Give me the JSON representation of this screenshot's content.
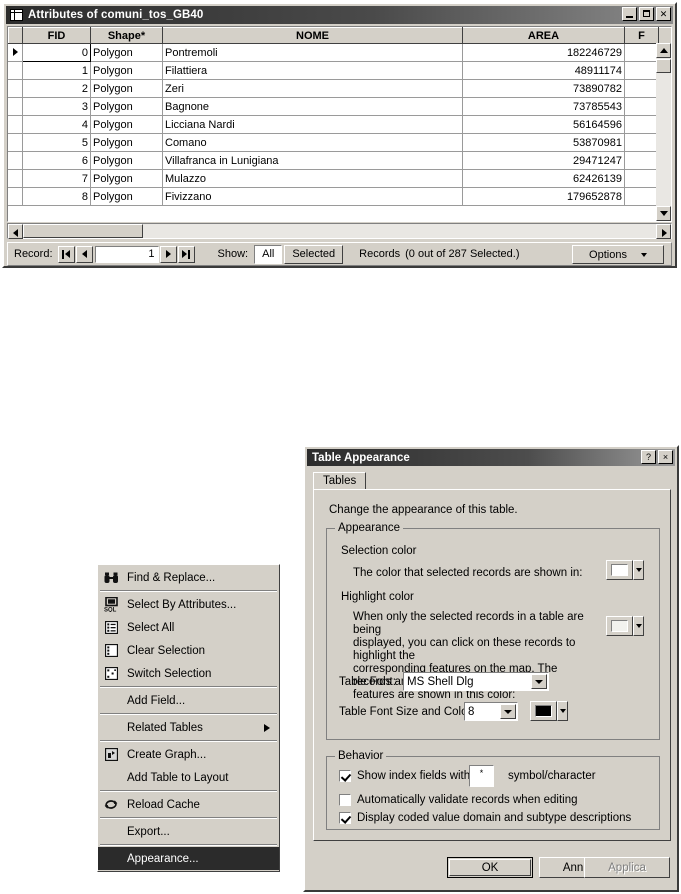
{
  "attribute_table": {
    "title": "Attributes of comuni_tos_GB40",
    "title_icon": "table-icon",
    "window_buttons": {
      "minimize": "minimize-icon",
      "maximize": "maximize-icon",
      "close": "close-icon"
    },
    "columns": [
      "FID",
      "Shape*",
      "NOME",
      "AREA",
      "F"
    ],
    "rows": [
      {
        "fid": "0",
        "shape": "Polygon",
        "nome": "Pontremoli",
        "area": "182246729"
      },
      {
        "fid": "1",
        "shape": "Polygon",
        "nome": "Filattiera",
        "area": "48911174"
      },
      {
        "fid": "2",
        "shape": "Polygon",
        "nome": "Zeri",
        "area": "73890782"
      },
      {
        "fid": "3",
        "shape": "Polygon",
        "nome": "Bagnone",
        "area": "73785543"
      },
      {
        "fid": "4",
        "shape": "Polygon",
        "nome": "Licciana Nardi",
        "area": "56164596"
      },
      {
        "fid": "5",
        "shape": "Polygon",
        "nome": "Comano",
        "area": "53870981"
      },
      {
        "fid": "6",
        "shape": "Polygon",
        "nome": "Villafranca in Lunigiana",
        "area": "29471247"
      },
      {
        "fid": "7",
        "shape": "Polygon",
        "nome": "Mulazzo",
        "area": "62426139"
      },
      {
        "fid": "8",
        "shape": "Polygon",
        "nome": "Fivizzano",
        "area": "179652878"
      }
    ],
    "statusbar": {
      "record_label": "Record:",
      "record_value": "1",
      "first_icon": "first-record-icon",
      "prev_icon": "previous-record-icon",
      "next_icon": "next-record-icon",
      "last_icon": "last-record-icon",
      "show_label": "Show:",
      "show_all": "All",
      "show_selected": "Selected",
      "records_label": "Records",
      "records_status": "(0 out of 287 Selected.)",
      "options_label": "Options"
    }
  },
  "context_menu": {
    "items": [
      {
        "label": "Find & Replace...",
        "icon": "binoculars-icon",
        "separator_after": true,
        "submenu": false,
        "highlighted": false
      },
      {
        "label": "Select By Attributes...",
        "icon": "sql-monitor-icon",
        "separator_after": false,
        "submenu": false,
        "highlighted": false
      },
      {
        "label": "Select All",
        "icon": "select-all-icon",
        "separator_after": false,
        "submenu": false,
        "highlighted": false
      },
      {
        "label": "Clear Selection",
        "icon": "clear-selection-icon",
        "separator_after": false,
        "submenu": false,
        "highlighted": false
      },
      {
        "label": "Switch Selection",
        "icon": "switch-selection-icon",
        "separator_after": true,
        "submenu": false,
        "highlighted": false
      },
      {
        "label": "Add Field...",
        "icon": "",
        "separator_after": true,
        "submenu": false,
        "highlighted": false
      },
      {
        "label": "Related Tables",
        "icon": "",
        "separator_after": true,
        "submenu": true,
        "highlighted": false
      },
      {
        "label": "Create Graph...",
        "icon": "create-graph-icon",
        "separator_after": false,
        "submenu": false,
        "highlighted": false
      },
      {
        "label": "Add Table to Layout",
        "icon": "",
        "separator_after": true,
        "submenu": false,
        "highlighted": false
      },
      {
        "label": "Reload Cache",
        "icon": "reload-cache-icon",
        "separator_after": true,
        "submenu": false,
        "highlighted": false
      },
      {
        "label": "Export...",
        "icon": "",
        "separator_after": true,
        "submenu": false,
        "highlighted": false
      },
      {
        "label": "Appearance...",
        "icon": "",
        "separator_after": false,
        "submenu": false,
        "highlighted": true
      }
    ]
  },
  "dialog": {
    "title": "Table Appearance",
    "help_button": "?",
    "close_button": "×",
    "tab": "Tables",
    "description": "Change the appearance of this table.",
    "appearance_group": {
      "legend": "Appearance",
      "selection_color_heading": "Selection color",
      "selection_color_text": "The color that selected records are shown in:",
      "selection_color_value": "#ffffff",
      "highlight_color_heading": "Highlight color",
      "highlight_color_text_line1": "When only the selected records in a table are being",
      "highlight_color_text_line2": "displayed, you can click on these records to highlight the",
      "highlight_color_text_line3": "corresponding features on the map. The records and",
      "highlight_color_text_line4": "features are shown in this color:",
      "highlight_color_value": "#f2f2ee",
      "table_font_label": "Table Font:",
      "table_font_value": "MS Shell Dlg",
      "table_font_size_label": "Table Font Size and Color:",
      "table_font_size_value": "8",
      "table_font_color_value": "#000000"
    },
    "behavior_group": {
      "legend": "Behavior",
      "show_index_fields_label": "Show index fields with",
      "show_index_fields_symbol": "*",
      "show_index_fields_suffix": "symbol/character",
      "show_index_fields_checked": true,
      "auto_validate_label": "Automatically validate records when editing",
      "auto_validate_checked": false,
      "coded_value_label": "Display coded value domain and subtype descriptions",
      "coded_value_checked": true
    },
    "buttons": {
      "ok": "OK",
      "cancel": "Annulla",
      "apply": "Applica"
    }
  }
}
